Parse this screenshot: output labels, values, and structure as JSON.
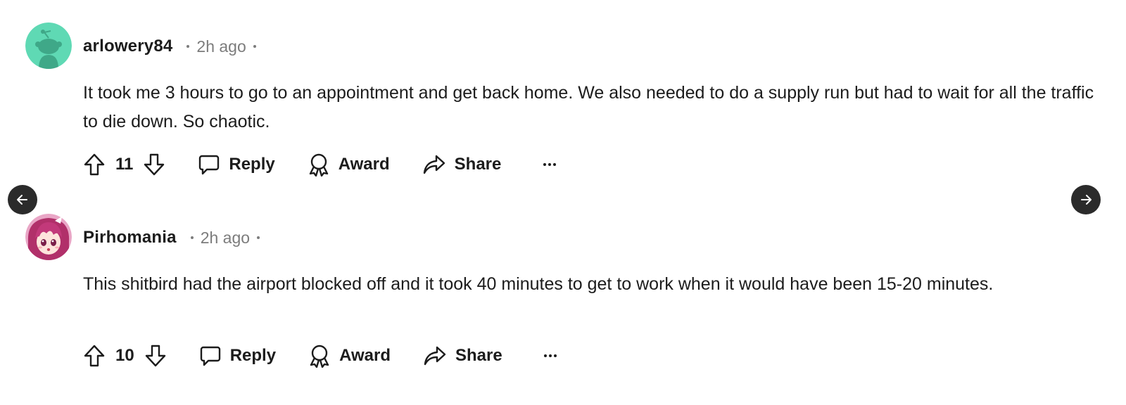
{
  "comments": [
    {
      "username": "arlowery84",
      "time": "2h ago",
      "avatar": "snoo-avatar-mint",
      "body": "It took me 3 hours to go to an appointment and get back home. We also needed to do a supply run but had to wait for all the traffic to die down. So chaotic.",
      "score": "11",
      "actions": {
        "reply": "Reply",
        "award": "Award",
        "share": "Share"
      }
    },
    {
      "username": "Pirhomania",
      "time": "2h ago",
      "avatar": "anime-girl-pink-hair-avatar",
      "body": "This shitbird had the airport blocked off and it took 40 minutes to get to work when it would have been 15-20 minutes.",
      "score": "10",
      "actions": {
        "reply": "Reply",
        "award": "Award",
        "share": "Share"
      }
    }
  ],
  "navigation": {
    "prev_icon": "arrow-left-icon",
    "next_icon": "arrow-right-icon"
  },
  "colors": {
    "text": "#1c1c1c",
    "muted": "#7c7c7c",
    "avatar_mint": "#5fd9b4",
    "avatar_figure": "#3fa888",
    "nav_button": "#2b2b2b"
  }
}
